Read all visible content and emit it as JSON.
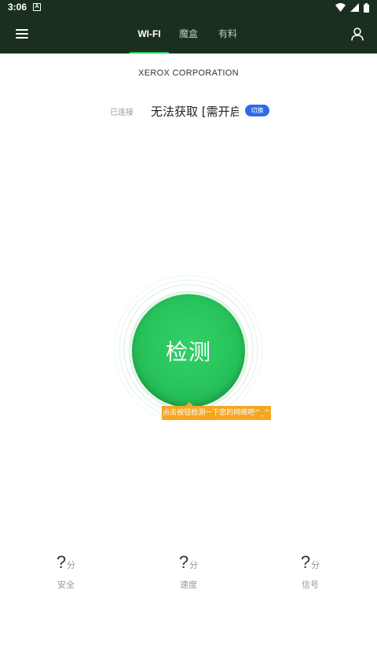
{
  "status_bar": {
    "time": "3:06",
    "notification_badge": "A",
    "icons": [
      "wifi-icon",
      "signal-icon",
      "battery-icon"
    ]
  },
  "app_bar": {
    "tabs": [
      {
        "label": "WI-FI",
        "active": true
      },
      {
        "label": "魔盒",
        "active": false
      },
      {
        "label": "有料",
        "active": false
      }
    ],
    "colors": {
      "background": "#1b2f20",
      "accent": "#2fc25b"
    }
  },
  "network": {
    "ssid": "XEROX CORPORATION",
    "connection_label": "已连接",
    "connection_value": "无法获取 [需开启",
    "switch_label": "切换"
  },
  "detect": {
    "button_label": "检测",
    "tooltip": "点击按钮检测一下您的网络吧^_^",
    "colors": {
      "button": "#27c25b",
      "tooltip": "#f5a623"
    }
  },
  "scores": [
    {
      "value": "?",
      "unit": "分",
      "label": "安全"
    },
    {
      "value": "?",
      "unit": "分",
      "label": "速度"
    },
    {
      "value": "?",
      "unit": "分",
      "label": "信号"
    }
  ]
}
